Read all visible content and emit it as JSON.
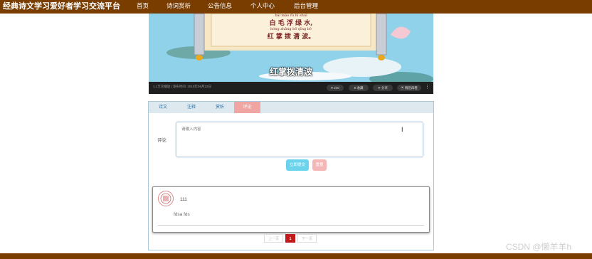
{
  "header": {
    "title": "经典诗文学习爱好者学习交流平台",
    "nav": [
      "首页",
      "诗词赏析",
      "公告信息",
      "个人中心",
      "后台管理"
    ]
  },
  "video": {
    "pinyin_line1": "bái  máo  fú  lǜ  shuǐ",
    "poem_line1": "白 毛 浮 绿 水,",
    "pinyin_line2": "hóng zhǎng  bō  qīng  bō",
    "poem_line2": "红 掌 拨 清 波。",
    "subtitle": "红掌拨清波",
    "info": "1.1万次播放 | 发布时间: 2019年08月22日",
    "buttons": [
      "240",
      "收藏",
      "分享",
      "稍后再看"
    ],
    "more_icon": "⋮"
  },
  "tabs": [
    "诗文",
    "注释",
    "赏析",
    "评论"
  ],
  "active_tab": 3,
  "comment_form": {
    "label": "评论",
    "placeholder": "请输入内容",
    "submit_label": "立即提交",
    "reset_label": "重置"
  },
  "comments": [
    {
      "user": "111",
      "text": "fdsa fds"
    }
  ],
  "pagination": {
    "prev": "上一页",
    "current": "1",
    "next": "下一页"
  },
  "watermark": "CSDN @懒羊羊h",
  "colors": {
    "header": "#7a3d00",
    "active_tab": "#f1a5a3",
    "submit": "#6bd4ec",
    "reset": "#f4b6b6",
    "page_current": "#c4191b"
  }
}
